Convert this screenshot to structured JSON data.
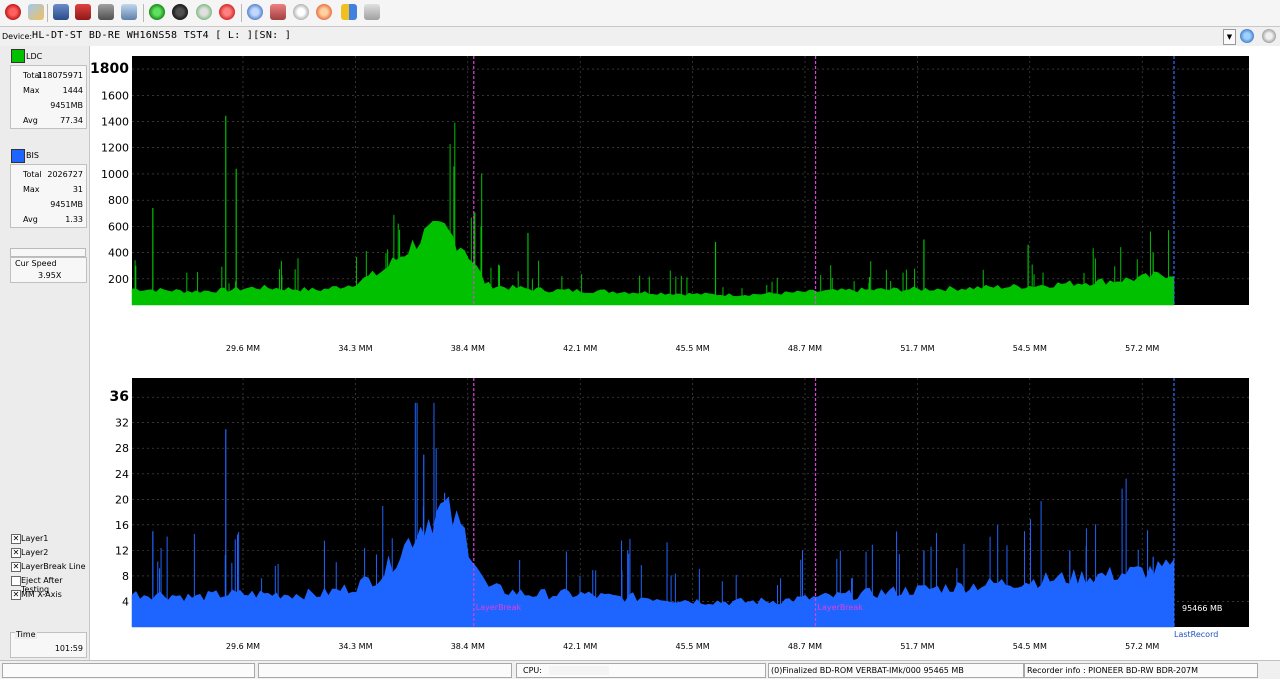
{
  "toolbar": {
    "icons": [
      "power-icon",
      "settings-icon",
      "drive-icon",
      "eject-disc-icon",
      "disc-icon",
      "burn-icon",
      "refresh-icon",
      "globe-icon",
      "export-icon",
      "stop-icon",
      "info-disc-icon",
      "disc-info-icon",
      "scan-icon",
      "fire-icon",
      "chart-icon",
      "print-icon"
    ]
  },
  "device": {
    "label": "Device:",
    "value": "HL-DT-ST  BD-RE   WH16NS58  TST4 [ L: ][SN:           ]"
  },
  "left_panel": {
    "ldc": {
      "title": "LDC",
      "color": "#00c000",
      "stats": [
        {
          "label": "Total",
          "value": "118075971"
        },
        {
          "label": "Max",
          "value": "1444"
        },
        {
          "label": "",
          "value": "9451MB"
        },
        {
          "label": "Avg",
          "value": "77.34"
        }
      ]
    },
    "bis": {
      "title": "BIS",
      "color": "#1e64ff",
      "stats": [
        {
          "label": "Total",
          "value": "2026727"
        },
        {
          "label": "Max",
          "value": "31"
        },
        {
          "label": "",
          "value": "9451MB"
        },
        {
          "label": "Avg",
          "value": "1.33"
        }
      ]
    },
    "cur_speed": {
      "label": "Cur Speed",
      "value": "3.95X"
    },
    "options": [
      {
        "label": "Layer1",
        "checked": true
      },
      {
        "label": "Layer2",
        "checked": true
      },
      {
        "label": "LayerBreak Line",
        "checked": true
      },
      {
        "label": "Eject After Testing",
        "checked": false
      },
      {
        "label": "MM X-Axis",
        "checked": true
      }
    ],
    "time": {
      "label": "Time",
      "value": "101:59"
    }
  },
  "chart_data": [
    {
      "type": "area",
      "series": [
        {
          "name": "LDC"
        }
      ],
      "color": "#00c000",
      "y_ticks": [
        "1800",
        "1600",
        "1400",
        "1200",
        "1000",
        "800",
        "600",
        "400",
        "200"
      ],
      "ylim": [
        0,
        1900
      ],
      "x_ticks": [
        "29.6 MM",
        "34.3 MM",
        "38.4 MM",
        "42.1 MM",
        "45.5 MM",
        "48.7 MM",
        "51.7 MM",
        "54.5 MM",
        "57.2 MM"
      ],
      "x": [
        0.0,
        0.03,
        0.06,
        0.09,
        0.12,
        0.15,
        0.18,
        0.21,
        0.24,
        0.26,
        0.28,
        0.3,
        0.32,
        0.34,
        0.36,
        0.38,
        0.4,
        0.43,
        0.46,
        0.5,
        0.54,
        0.58,
        0.62,
        0.66,
        0.7,
        0.74,
        0.78,
        0.82,
        0.86,
        0.9,
        0.94,
        0.97,
        1.0
      ],
      "values": [
        120,
        110,
        100,
        110,
        130,
        120,
        110,
        150,
        250,
        380,
        520,
        560,
        420,
        150,
        130,
        120,
        110,
        105,
        100,
        90,
        80,
        75,
        85,
        100,
        110,
        115,
        120,
        130,
        140,
        160,
        180,
        200,
        240
      ],
      "spikes": [
        [
          0.09,
          1444
        ],
        [
          0.1,
          1040
        ],
        [
          0.02,
          740
        ],
        [
          0.335,
          600
        ],
        [
          0.38,
          550
        ],
        [
          0.56,
          480
        ],
        [
          0.76,
          500
        ],
        [
          0.86,
          460
        ],
        [
          0.98,
          400
        ]
      ],
      "layer_breaks": [
        0.328,
        0.656
      ],
      "end_marker": 1.0,
      "grid": true
    },
    {
      "type": "area",
      "series": [
        {
          "name": "BIS"
        }
      ],
      "color": "#1e64ff",
      "y_ticks": [
        "36",
        "32",
        "28",
        "24",
        "20",
        "16",
        "12",
        "8",
        "4"
      ],
      "ylim": [
        0,
        39
      ],
      "x_ticks": [
        "29.6 MM",
        "34.3 MM",
        "38.4 MM",
        "42.1 MM",
        "45.5 MM",
        "48.7 MM",
        "51.7 MM",
        "54.5 MM",
        "57.2 MM"
      ],
      "x": [
        0.0,
        0.03,
        0.06,
        0.09,
        0.12,
        0.15,
        0.18,
        0.21,
        0.24,
        0.26,
        0.28,
        0.3,
        0.32,
        0.34,
        0.36,
        0.38,
        0.4,
        0.43,
        0.46,
        0.5,
        0.54,
        0.58,
        0.62,
        0.66,
        0.7,
        0.74,
        0.78,
        0.82,
        0.86,
        0.9,
        0.94,
        0.97,
        1.0
      ],
      "values": [
        5,
        5,
        4.5,
        5,
        5,
        5,
        5,
        6,
        8,
        12,
        16,
        18,
        14,
        6,
        5.5,
        5,
        5,
        5,
        4.5,
        4.5,
        4,
        3.8,
        4,
        4.5,
        5,
        5.5,
        6,
        6.5,
        7,
        7.5,
        8,
        8.5,
        9
      ],
      "spikes": [
        [
          0.09,
          31
        ],
        [
          0.02,
          15
        ],
        [
          0.28,
          27
        ],
        [
          0.3,
          21
        ],
        [
          0.76,
          12
        ],
        [
          0.9,
          12
        ],
        [
          0.98,
          11
        ]
      ],
      "layer_breaks": [
        0.328,
        0.656
      ],
      "layer_break_label": "LayerBreak",
      "end_marker": 1.0,
      "end_value": "95466 MB",
      "end_label": "LastRecord",
      "grid": true
    }
  ],
  "status_bar": {
    "cpu_label": "CPU:",
    "disc_info": "(0)Finalized  BD-ROM  VERBAT-IMk/000  95465 MB",
    "recorder": "Recorder info : PIONEER     BD-RW  BDR-207M"
  }
}
